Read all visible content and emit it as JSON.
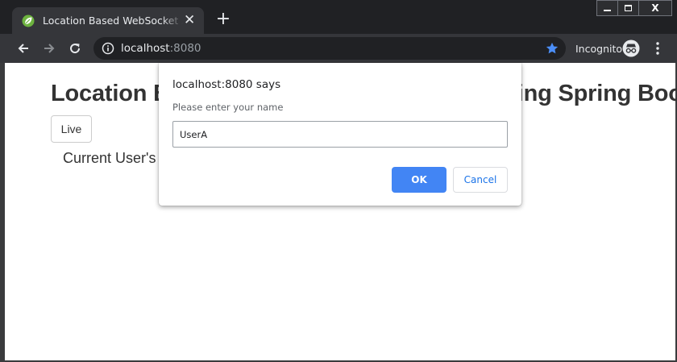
{
  "browser": {
    "tab_title": "Location Based WebSocket Application",
    "tab_favicon": "spring-leaf-icon",
    "url_host": "localhost",
    "url_port": ":8080",
    "incognito_label": "Incognito",
    "window_controls": {
      "minimize": "minimize-icon",
      "maximize": "maximize-icon",
      "close": "X"
    },
    "accent_color": "#4285f4"
  },
  "page": {
    "title": "Location Based WebSocket Application using Spring Boot",
    "live_button": "Live",
    "user_location_label": "Current User's Location"
  },
  "dialog": {
    "title": "localhost:8080 says",
    "message": "Please enter your name",
    "input_value": "UserA",
    "ok_label": "OK",
    "cancel_label": "Cancel"
  }
}
